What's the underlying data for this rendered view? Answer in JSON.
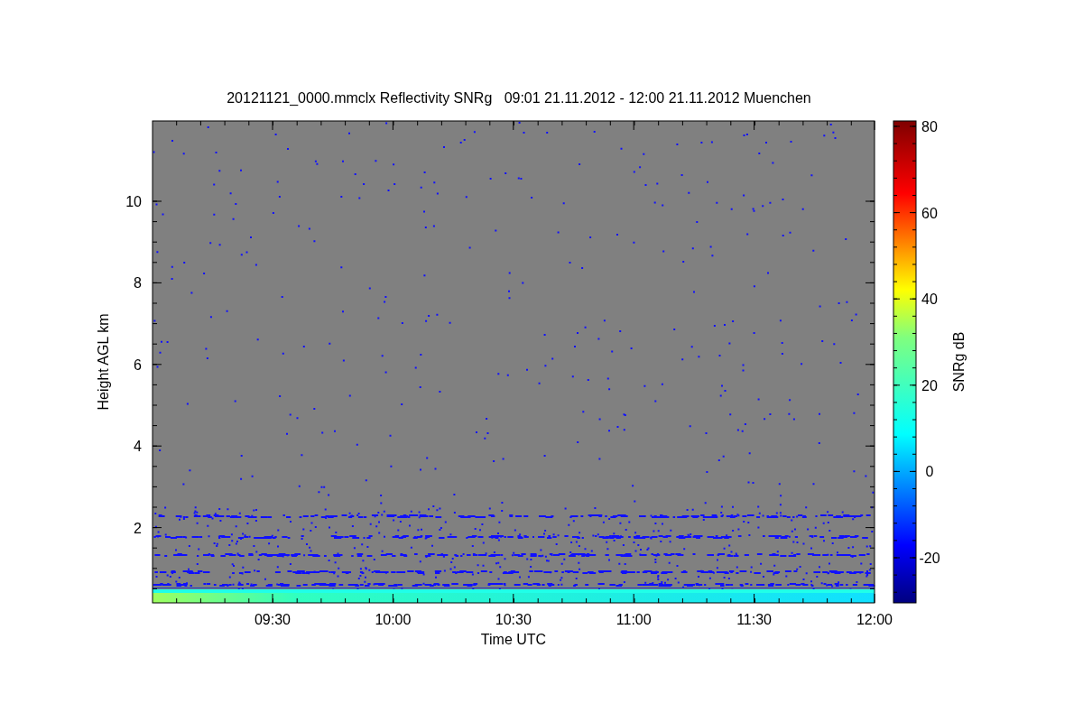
{
  "title": "20121121_0000.mmclx Reflectivity SNRg   09:01 21.11.2012 - 12:00 21.11.2012 Muenchen",
  "plot": {
    "xlabel": "Time UTC",
    "ylabel": "Height AGL km",
    "xticks": [
      "09:30",
      "10:00",
      "10:30",
      "11:00",
      "11:30",
      "12:00"
    ],
    "yticks": [
      "10",
      "8",
      "6",
      "4",
      "2"
    ]
  },
  "colorbar": {
    "label": "SNRg dB",
    "ticks": [
      "80",
      "60",
      "40",
      "20",
      "0",
      "-20"
    ]
  }
}
